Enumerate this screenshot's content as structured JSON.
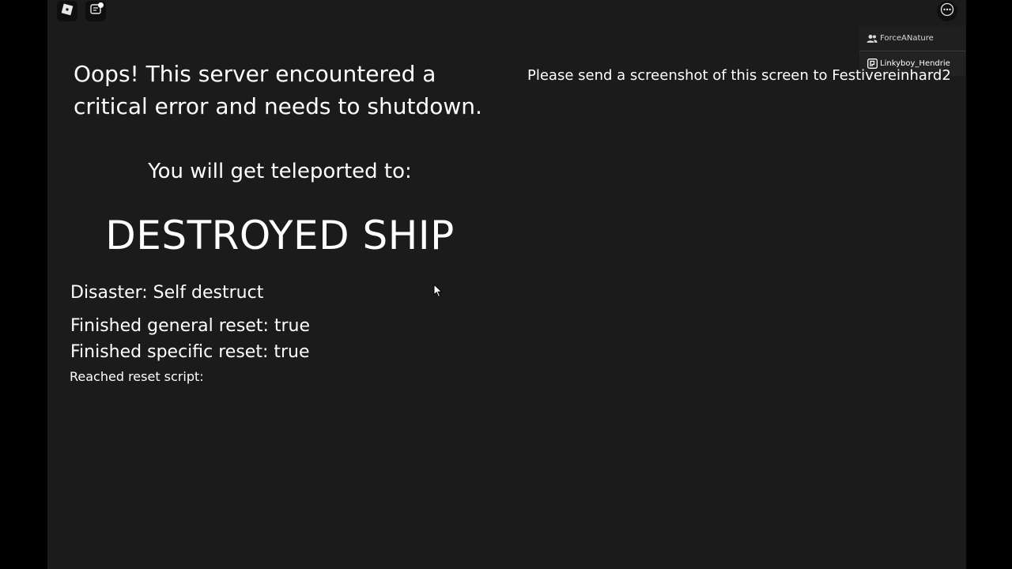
{
  "topbar": {
    "roblox_button_icon": "roblox-logo-icon",
    "chat_button_icon": "chat-icon",
    "menu_button_icon": "more-options-icon"
  },
  "playerlist": {
    "players": [
      {
        "name": "ForceANature",
        "icon": "friends-icon"
      },
      {
        "name": "Linkyboy_Hendrie",
        "icon": "premium-icon"
      }
    ]
  },
  "error_screen": {
    "title": "Oops! This server encountered a\ncritical error and needs to shutdown.",
    "request": "Please send a screenshot of this screen to Festivereinhard2",
    "teleport_label": "You will get teleported to:",
    "destination": "DESTROYED SHIP",
    "disaster": "Disaster: Self destruct",
    "general_reset": "Finished general reset: true",
    "specific_reset": "Finished specific reset: true",
    "reset_script": "Reached reset script:"
  },
  "colors": {
    "background": "#1b1b1b",
    "letterbox": "#000000",
    "text": "#ffffff"
  }
}
